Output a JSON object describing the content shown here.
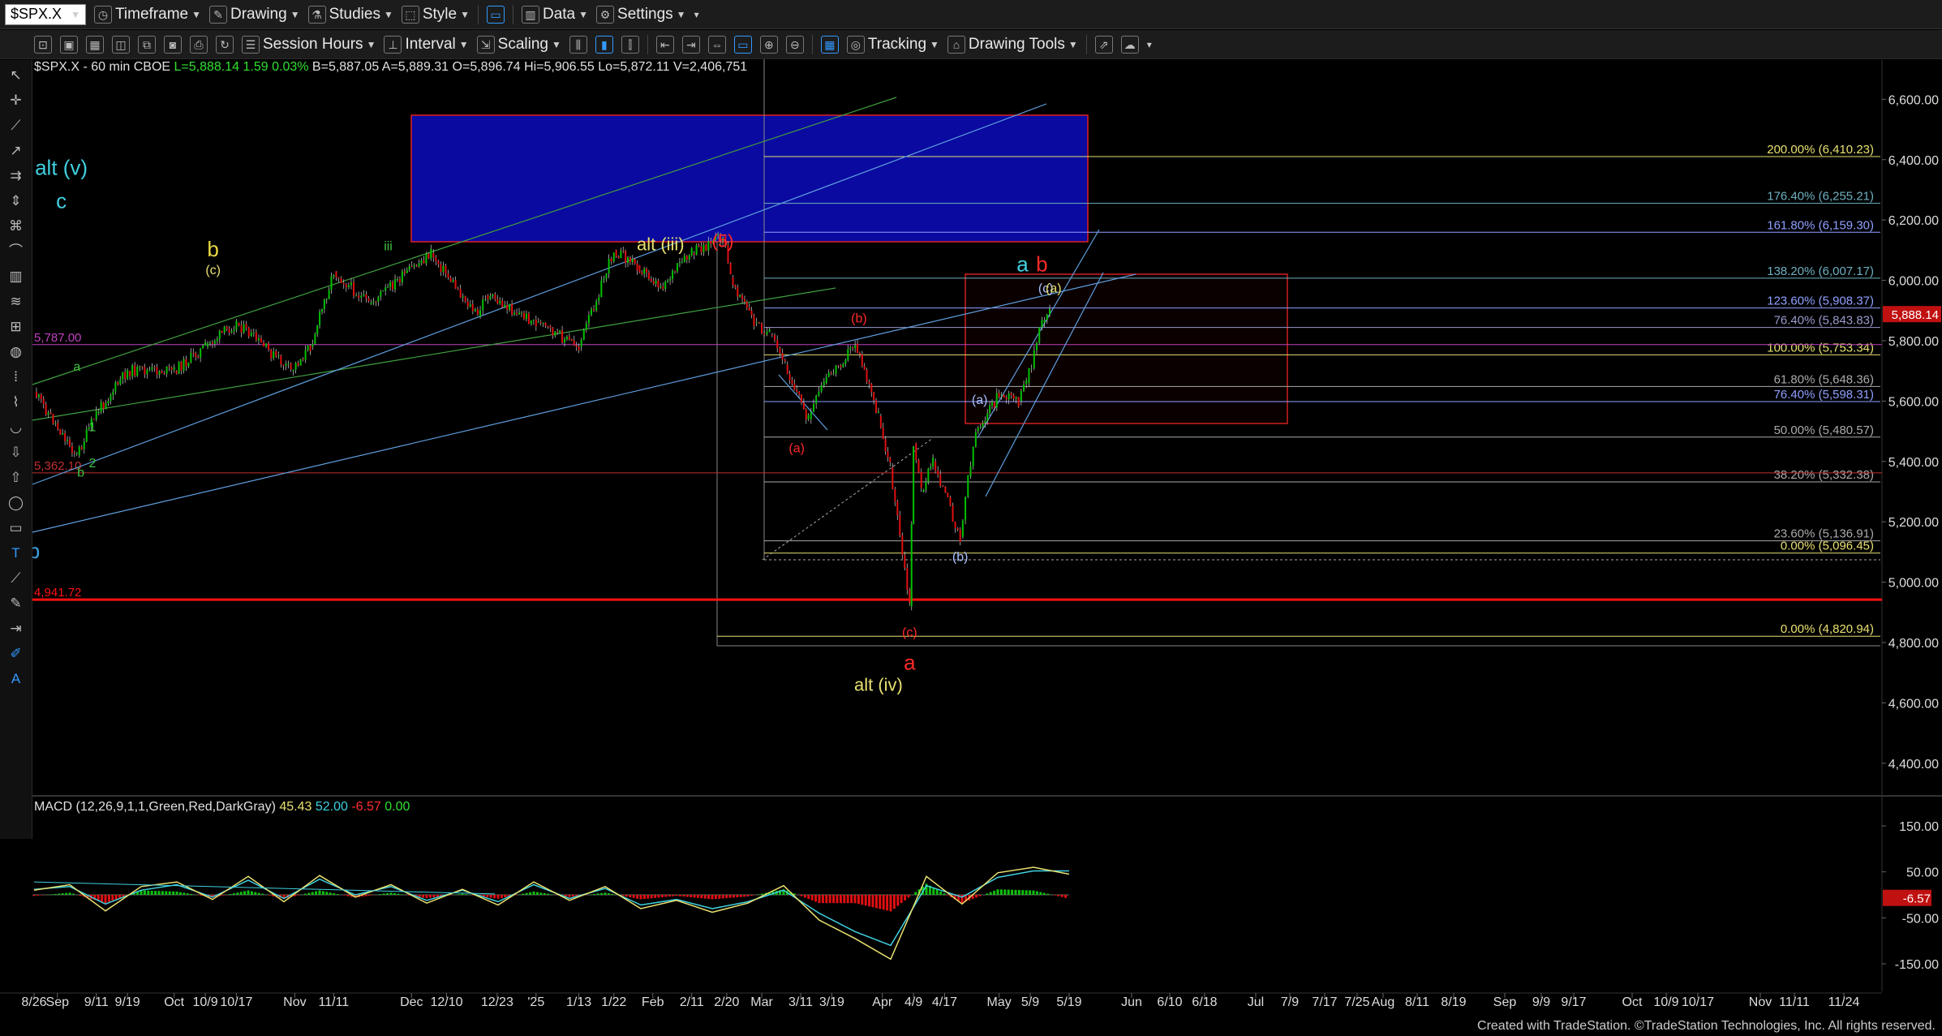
{
  "toolbar": {
    "symbol": "$SPX.X",
    "timeframe": "Timeframe",
    "drawing": "Drawing",
    "studies": "Studies",
    "style": "Style",
    "data": "Data",
    "settings": "Settings"
  },
  "toolbar2": {
    "session_hours": "Session Hours",
    "interval": "Interval",
    "scaling": "Scaling",
    "tracking": "Tracking",
    "drawing_tools": "Drawing Tools"
  },
  "price_info": {
    "symbol_line": "$SPX.X - 60 min  CBOE",
    "last": "L=5,888.14",
    "change": "1.59",
    "change_pct": "0.03%",
    "bid": "B=5,887.05",
    "ask": "A=5,889.31",
    "open": "O=5,896.74",
    "high": "Hi=5,906.55",
    "low": "Lo=5,872.11",
    "volume": "V=2,406,751"
  },
  "macd_info": {
    "name": "MACD (12,26,9,1,1,Green,Red,DarkGray)",
    "macd": "45.43",
    "signal": "52.00",
    "diff": "-6.57",
    "zero": "0.00"
  },
  "footer": "Created with TradeStation. ©TradeStation Technologies, Inc. All rights reserved.",
  "colors": {
    "background": "#000000",
    "up_bar": "#00c000",
    "down_bar": "#e01010",
    "fib_yellow": "#e8e070",
    "fib_blue": "#8fa0ff",
    "cyan_label": "#40d0e0",
    "red_label": "#ff2a2a",
    "blue_box": "#0a0aa0"
  },
  "chart_data": [
    {
      "type": "line",
      "title": "$SPX.X - 60 min",
      "x_tick_labels": [
        "8/26",
        "Sep",
        "9/11",
        "9/19",
        "Oct",
        "10/9",
        "10/17",
        "Nov",
        "11/11",
        "Dec",
        "12/10",
        "12/23",
        "'25",
        "1/13",
        "1/22",
        "Feb",
        "2/11",
        "2/20",
        "Mar",
        "3/11",
        "3/19",
        "Apr",
        "4/9",
        "4/17",
        "May",
        "5/9",
        "5/19",
        "Jun",
        "6/10",
        "6/18",
        "Jul",
        "7/9",
        "7/17",
        "7/25",
        "Aug",
        "8/11",
        "8/19",
        "Sep",
        "9/9",
        "9/17",
        "Oct",
        "10/9",
        "10/17",
        "Nov",
        "11/11",
        "11/24"
      ],
      "y_tick_labels": [
        "6,600.00",
        "6,400.00",
        "6,200.00",
        "6,000.00",
        "5,800.00",
        "5,600.00",
        "5,400.00",
        "5,200.00",
        "5,000.00",
        "4,800.00",
        "4,600.00",
        "4,400.00"
      ],
      "ylim": [
        4300,
        6730
      ],
      "last_price_tag": "5,888.14",
      "series": [
        {
          "x": [
            "8/26",
            "9/6",
            "9/11",
            "9/19",
            "10/1",
            "10/9",
            "10/17",
            "10/31",
            "11/5",
            "11/11",
            "11/20",
            "12/6",
            "12/18",
            "12/20",
            "1/2",
            "1/13",
            "1/22",
            "1/28",
            "2/3",
            "2/11",
            "2/19",
            "2/21",
            "2/27",
            "3/3",
            "3/7",
            "3/13",
            "3/17",
            "3/25",
            "3/31",
            "4/3",
            "4/8",
            "4/9",
            "4/11",
            "4/14",
            "4/21",
            "4/23",
            "4/25",
            "5/1",
            "5/6",
            "5/8",
            "5/12",
            "5/14"
          ],
          "values": [
            5630,
            5420,
            5560,
            5700,
            5700,
            5780,
            5860,
            5700,
            5780,
            6030,
            5920,
            6090,
            5880,
            5950,
            5860,
            5780,
            6100,
            6050,
            5980,
            6090,
            6147,
            6010,
            5860,
            5820,
            5720,
            5540,
            5660,
            5790,
            5550,
            5380,
            4920,
            5460,
            5300,
            5400,
            5150,
            5350,
            5500,
            5620,
            5600,
            5660,
            5860,
            5906
          ]
        }
      ],
      "horizontal_levels": [
        {
          "label": "5,787.00",
          "value": 5787
        },
        {
          "label": "5,362.10",
          "value": 5362
        },
        {
          "label": "4,941.72",
          "value": 4942
        }
      ],
      "fib_levels": [
        {
          "label": "200.00% (6,410.23)",
          "value": 6410.23
        },
        {
          "label": "176.40% (6,255.21)",
          "value": 6255.21
        },
        {
          "label": "161.80% (6,159.30)",
          "value": 6159.3
        },
        {
          "label": "138.20% (6,007.17)",
          "value": 6007.17
        },
        {
          "label": "123.60% (5,908.37)",
          "value": 5908.37
        },
        {
          "label": "76.40% (5,843.83)",
          "value": 5843.83
        },
        {
          "label": "100.00% (5,753.34)",
          "value": 5753.34
        },
        {
          "label": "61.80% (5,648.36)",
          "value": 5648.36
        },
        {
          "label": "76.40% (5,598.31)",
          "value": 5598.31
        },
        {
          "label": "50.00% (5,480.57)",
          "value": 5480.57
        },
        {
          "label": "38.20% (5,332.38)",
          "value": 5332.38
        },
        {
          "label": "23.60% (5,136.91)",
          "value": 5136.91
        },
        {
          "label": "0.00% (5,096.45)",
          "value": 5096.45
        },
        {
          "label": "0.00% (4,820.94)",
          "value": 4820.94
        }
      ],
      "wave_labels": [
        {
          "text": "iii",
          "x": "11/25",
          "y": 6100
        },
        {
          "text": "alt (iii)",
          "x": "2/3",
          "y": 6100
        },
        {
          "text": "(5)",
          "x": "2/19",
          "y": 6110
        },
        {
          "text": "a",
          "x": "9/6",
          "y": 5700
        },
        {
          "text": "1",
          "x": "9/10",
          "y": 5500
        },
        {
          "text": "b",
          "x": "9/7",
          "y": 5350
        },
        {
          "text": "2",
          "x": "9/10",
          "y": 5380
        },
        {
          "text": "(b)",
          "x": "3/26",
          "y": 5860
        },
        {
          "text": "(a)",
          "x": "3/10",
          "y": 5430
        },
        {
          "text": "(a)",
          "x": "4/26",
          "y": 5590
        },
        {
          "text": "(c)",
          "x": "4/8",
          "y": 4820
        },
        {
          "text": "a",
          "x": "4/8",
          "y": 4710
        },
        {
          "text": "alt (iv)",
          "x": "3/31",
          "y": 4640
        },
        {
          "text": "(b)",
          "x": "4/21",
          "y": 5070
        },
        {
          "text": "a",
          "x": "5/7",
          "y": 6030
        },
        {
          "text": "b",
          "x": "5/12",
          "y": 6030
        },
        {
          "text": "(c)",
          "x": "5/13",
          "y": 5960
        },
        {
          "text": "(a)",
          "x": "5/15",
          "y": 5960
        },
        {
          "text": "alt (v)",
          "x": "9/2",
          "y": 6350
        },
        {
          "text": "c",
          "x": "9/2",
          "y": 6240
        },
        {
          "text": "b",
          "x": "10/11",
          "y": 6080
        },
        {
          "text": "(c)",
          "x": "10/11",
          "y": 6020
        },
        {
          "text": "(b)",
          "x": "8/23",
          "y": 5080
        },
        {
          "text": "b",
          "x": "8/26",
          "y": 5080
        }
      ]
    },
    {
      "type": "line",
      "title": "MACD (12,26,9,1,1,Green,Red,DarkGray)",
      "y_tick_labels": [
        "150.00",
        "50.00",
        "-50.00",
        "-150.00"
      ],
      "ylim": [
        -210,
        210
      ],
      "last_value_tag": "-6.57",
      "series": [
        {
          "name": "MACD",
          "values": [
            10,
            22,
            -35,
            18,
            28,
            -10,
            40,
            -15,
            42,
            -5,
            22,
            -18,
            12,
            -22,
            28,
            -12,
            18,
            -30,
            -12,
            -38,
            -18,
            20,
            -55,
            -95,
            -140,
            40,
            -20,
            48,
            60,
            45
          ]
        },
        {
          "name": "Signal",
          "values": [
            12,
            18,
            -20,
            10,
            22,
            -5,
            32,
            -8,
            34,
            0,
            18,
            -12,
            10,
            -15,
            22,
            -8,
            14,
            -22,
            -10,
            -30,
            -15,
            10,
            -40,
            -80,
            -110,
            20,
            -5,
            38,
            52,
            52
          ]
        }
      ]
    }
  ]
}
